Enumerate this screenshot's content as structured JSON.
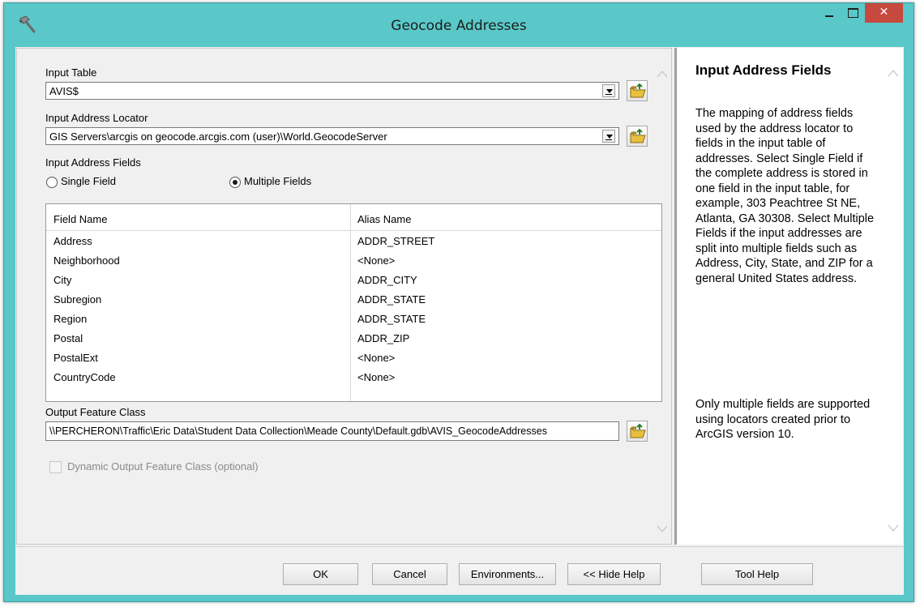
{
  "window": {
    "title": "Geocode Addresses",
    "close_label": "✕",
    "app_icon": "hammer-icon"
  },
  "form": {
    "input_table": {
      "label": "Input Table",
      "value": "AVIS$"
    },
    "input_locator": {
      "label": "Input Address Locator",
      "value": "GIS Servers\\arcgis on geocode.arcgis.com (user)\\World.GeocodeServer"
    },
    "address_fields": {
      "label": "Input Address Fields",
      "single_label": "Single Field",
      "multiple_label": "Multiple Fields",
      "selected": "Multiple Fields"
    },
    "table": {
      "headers": [
        "Field Name",
        "Alias Name"
      ],
      "rows": [
        {
          "field": "Address",
          "alias": "ADDR_STREET"
        },
        {
          "field": "Neighborhood",
          "alias": "<None>"
        },
        {
          "field": "City",
          "alias": "ADDR_CITY"
        },
        {
          "field": "Subregion",
          "alias": "ADDR_STATE"
        },
        {
          "field": "Region",
          "alias": "ADDR_STATE"
        },
        {
          "field": "Postal",
          "alias": "ADDR_ZIP"
        },
        {
          "field": "PostalExt",
          "alias": "<None>"
        },
        {
          "field": "CountryCode",
          "alias": "<None>"
        }
      ]
    },
    "output": {
      "label": "Output Feature Class",
      "value": "\\\\PERCHERON\\Traffic\\Eric Data\\Student Data Collection\\Meade County\\Default.gdb\\AVIS_GeocodeAddresses"
    },
    "dynamic_output": {
      "label": "Dynamic Output Feature Class (optional)",
      "checked": false,
      "enabled": false
    }
  },
  "help": {
    "title": "Input Address Fields",
    "paragraph1": "The mapping of address fields used by the address locator to fields in the input table of addresses. Select Single Field if the complete address is stored in one field in the input table, for example, 303 Peachtree St NE, Atlanta, GA 30308. Select Multiple Fields if the input addresses are split into multiple fields such as Address, City, State, and ZIP for a general United States address.",
    "paragraph2": "Only multiple fields are supported using locators created prior to ArcGIS version 10."
  },
  "buttons": {
    "ok": "OK",
    "cancel": "Cancel",
    "environments": "Environments...",
    "hide_help": "<< Hide Help",
    "tool_help": "Tool Help"
  },
  "colors": {
    "title_bar": "#5ac8c8",
    "close_button": "#c7493e",
    "dialog_bg": "#f0f0f0"
  }
}
